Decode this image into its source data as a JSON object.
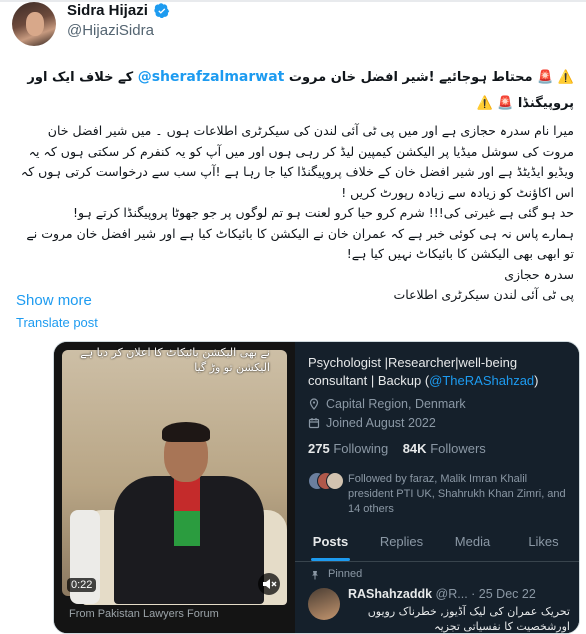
{
  "author": {
    "display_name": "Sidra Hijazi",
    "handle": "@HijaziSidra"
  },
  "tweet": {
    "title_pre": "⚠️ 🚨 محتاط ہوجائیے !شیر افضل خان مروت",
    "mention": "@sherafzalmarwat",
    "title_post": "کے خلاف ایک اور پروپیگنڈا 🚨 ⚠️",
    "para1": "میرا نام سدرہ حجازی ہے اور میں پی ٹی آئی لندن کی سیکرٹری اطلاعات ہوں ۔ میں شیر افضل خان مروت کی سوشل میڈیا پر الیکشن کیمپین لیڈ کر رہی ہوں اور میں آپ کو یہ کنفرم کر سکتی ہوں کہ یہ ویڈیو ایڈیٹڈ ہے اور شیر افضل خان کے خلاف پروپیگنڈا کیا جا رہا ہے !آپ سب سے درخواست کرتی ہوں کہ اس اکاؤنٹ کو زیادہ سے زیادہ رپورٹ کریں !",
    "line2": "حد ہو گئی ہے غیرتی کی!!! شرم کرو حیا کرو لعنت ہو تم لوگوں پر جو جھوٹا پروپیگنڈا کرتے ہو!",
    "line3": "ہمارے پاس نہ ہی کوئی خبر ہے کہ عمران خان نے الیکشن کا بائیکاٹ کیا ہے اور شیر افضل خان مروت نے تو ابھی بھی الیکشن کا بائیکاٹ نہیں کیا ہے!",
    "sign1": "سدرہ حجازی",
    "sign2": "پی ٹی آئی لندن سیکرٹری اطلاعات",
    "show_more": "Show more",
    "translate": "Translate post"
  },
  "media": {
    "video": {
      "overlay_text": "نے بھی الیکشن بائیکاٹ کا اعلان کر دیا ہے الیکشن تو وڑ گیا",
      "duration": "0:22",
      "source": "From Pakistan Lawyers Forum"
    },
    "profile": {
      "bio_text": "Psychologist |Researcher|well-being consultant | Backup (",
      "bio_link": "@TheRAShahzad",
      "bio_end": ")",
      "location": "Capital Region, Denmark",
      "joined": "Joined August 2022",
      "following_count": "275",
      "following_label": "Following",
      "followers_count": "84K",
      "followers_label": "Followers",
      "followed_by": "Followed by faraz, Malik Imran Khalil president PTI UK, Shahrukh Khan Zimri, and 14 others",
      "tabs": [
        "Posts",
        "Replies",
        "Media",
        "Likes"
      ],
      "pinned_label": "Pinned",
      "post_name": "RAShahzaddk",
      "post_handle": "@R...",
      "post_date": "· 25 Dec 22",
      "post_text": "تحریک عمران کی لیک آڈیوز, خطرناک رویوں اورشخصیت کا نفسیاتی تجزیہ"
    }
  },
  "colors": {
    "link": "#1d9bf0",
    "profile_bg": "#15202b",
    "muted": "#536471"
  }
}
